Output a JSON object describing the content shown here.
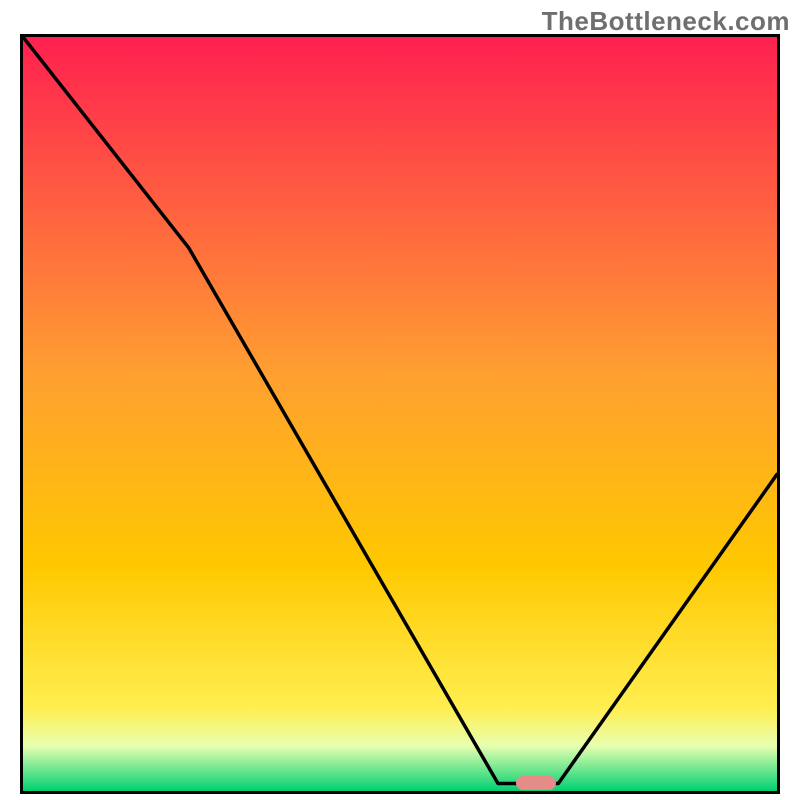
{
  "watermark": "TheBottleneck.com",
  "chart_data": {
    "type": "line",
    "title": "",
    "xlabel": "",
    "ylabel": "",
    "xlim": [
      0,
      100
    ],
    "ylim": [
      0,
      100
    ],
    "gradient_colors": {
      "top": "#ff2050",
      "mid_upper": "#ffc800",
      "mid_lower": "#ffee50",
      "band": "#e8ffb0",
      "bottom": "#00d070"
    },
    "curve_description": "V-shaped curve starting from top-left, descending with a slight bend near the upper-left region, reaching a minimum plateau roughly two-thirds across the x-axis near the bottom, then rising steeply toward the right edge.",
    "series": [
      {
        "name": "bottleneck-curve",
        "x": [
          0,
          22,
          63,
          71,
          100
        ],
        "y": [
          100,
          72,
          1,
          1,
          42
        ]
      }
    ],
    "marker": {
      "x": 68,
      "y": 1,
      "color": "#e58b88"
    }
  }
}
